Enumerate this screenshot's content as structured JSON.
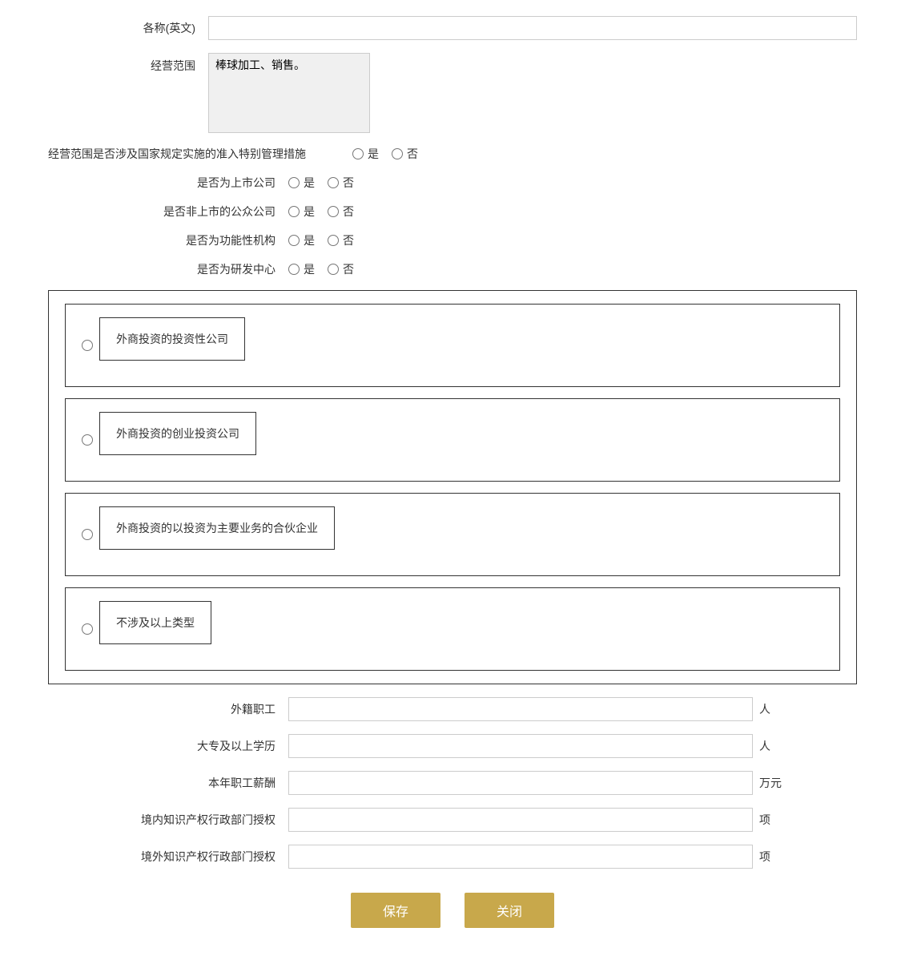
{
  "form": {
    "name_en_label": "各称(英文)",
    "name_en_value": "",
    "name_en_placeholder": "",
    "business_scope_label": "经营范围",
    "business_scope_value": "棒球加工、销售。",
    "special_management_label": "经营范围是否涉及国家规定实施的准入特别管理措施",
    "special_management_yes": "是",
    "special_management_no": "否",
    "listed_company_label": "是否为上市公司",
    "listed_yes": "是",
    "listed_no": "否",
    "non_listed_public_label": "是否非上市的公众公司",
    "non_listed_yes": "是",
    "non_listed_no": "否",
    "functional_org_label": "是否为功能性机构",
    "functional_yes": "是",
    "functional_no": "否",
    "rd_center_label": "是否为研发中心",
    "rd_yes": "是",
    "rd_no": "否",
    "invest_company_option": "外商投资的投资性公司",
    "venture_invest_option": "外商投资的创业投资公司",
    "main_business_option": "外商投资的以投资为主要业务的合伙企业",
    "not_involved_option": "不涉及以上类型",
    "foreign_staff_label": "外籍职工",
    "foreign_staff_value": "",
    "foreign_staff_unit": "人",
    "college_above_label": "大专及以上学历",
    "college_above_value": "",
    "college_above_unit": "人",
    "salary_label": "本年职工薪酬",
    "salary_value": "",
    "salary_unit": "万元",
    "domestic_ip_label": "境内知识产权行政部门授权",
    "domestic_ip_value": "",
    "domestic_ip_unit": "项",
    "foreign_ip_label": "境外知识产权行政部门授权",
    "foreign_ip_value": "",
    "foreign_ip_unit": "项",
    "save_btn": "保存",
    "close_btn": "关闭"
  }
}
